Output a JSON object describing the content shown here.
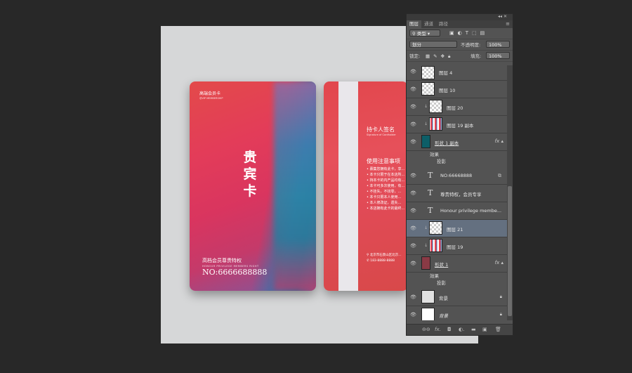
{
  "front_card": {
    "brand": "高端会员卡",
    "brand_sub": "@VIP MEMBERSHIP",
    "title": "贵宾卡",
    "privilege": "高档会员尊贵特权",
    "privilege_en": "HONOUR PRIVILEGE MEMBERS RIGHT",
    "number": "NO:6666688888"
  },
  "back_card": {
    "sign_label": "持卡人签名",
    "sign_label_en": "Signature of Cardholder",
    "notice_title": "使用注意事项",
    "rules": [
      "• 募集您拥有此卡，享...",
      "• 本卡只限于在本店所...",
      "• 持本卡的内产品均有...",
      "• 本卡可多次使用，有...",
      "• 不挂失，不找零，...",
      "• 本卡只限本人使用...",
      "• 本人修改证，遗失...",
      "• 本店拥有此卡的最终..."
    ],
    "address": "北京市石景山区北京...",
    "phone": "183-8888-8888"
  },
  "panel": {
    "tabs": [
      "图层",
      "通道",
      "路径"
    ],
    "filter_label": "类型",
    "blend_mode": "划分",
    "opacity_label": "不透明度:",
    "opacity_value": "100%",
    "lock_label": "锁定:",
    "fill_label": "填充:",
    "fill_value": "100%",
    "layers": [
      {
        "name": "图层 4"
      },
      {
        "name": "图层 10"
      },
      {
        "name": "图层 20"
      },
      {
        "name": "图层 19 副本"
      },
      {
        "name": "形状 1 副本",
        "effects": "效果",
        "shadow": "投影"
      },
      {
        "name": "NO:66668888"
      },
      {
        "name": "尊贵特权，会员专享"
      },
      {
        "name": "Honour privilege membe..."
      },
      {
        "name": "图层 21"
      },
      {
        "name": "图层 19"
      },
      {
        "name": "形状 1",
        "effects": "效果",
        "shadow": "投影"
      },
      {
        "name": "背景"
      },
      {
        "name": "背景"
      }
    ]
  }
}
